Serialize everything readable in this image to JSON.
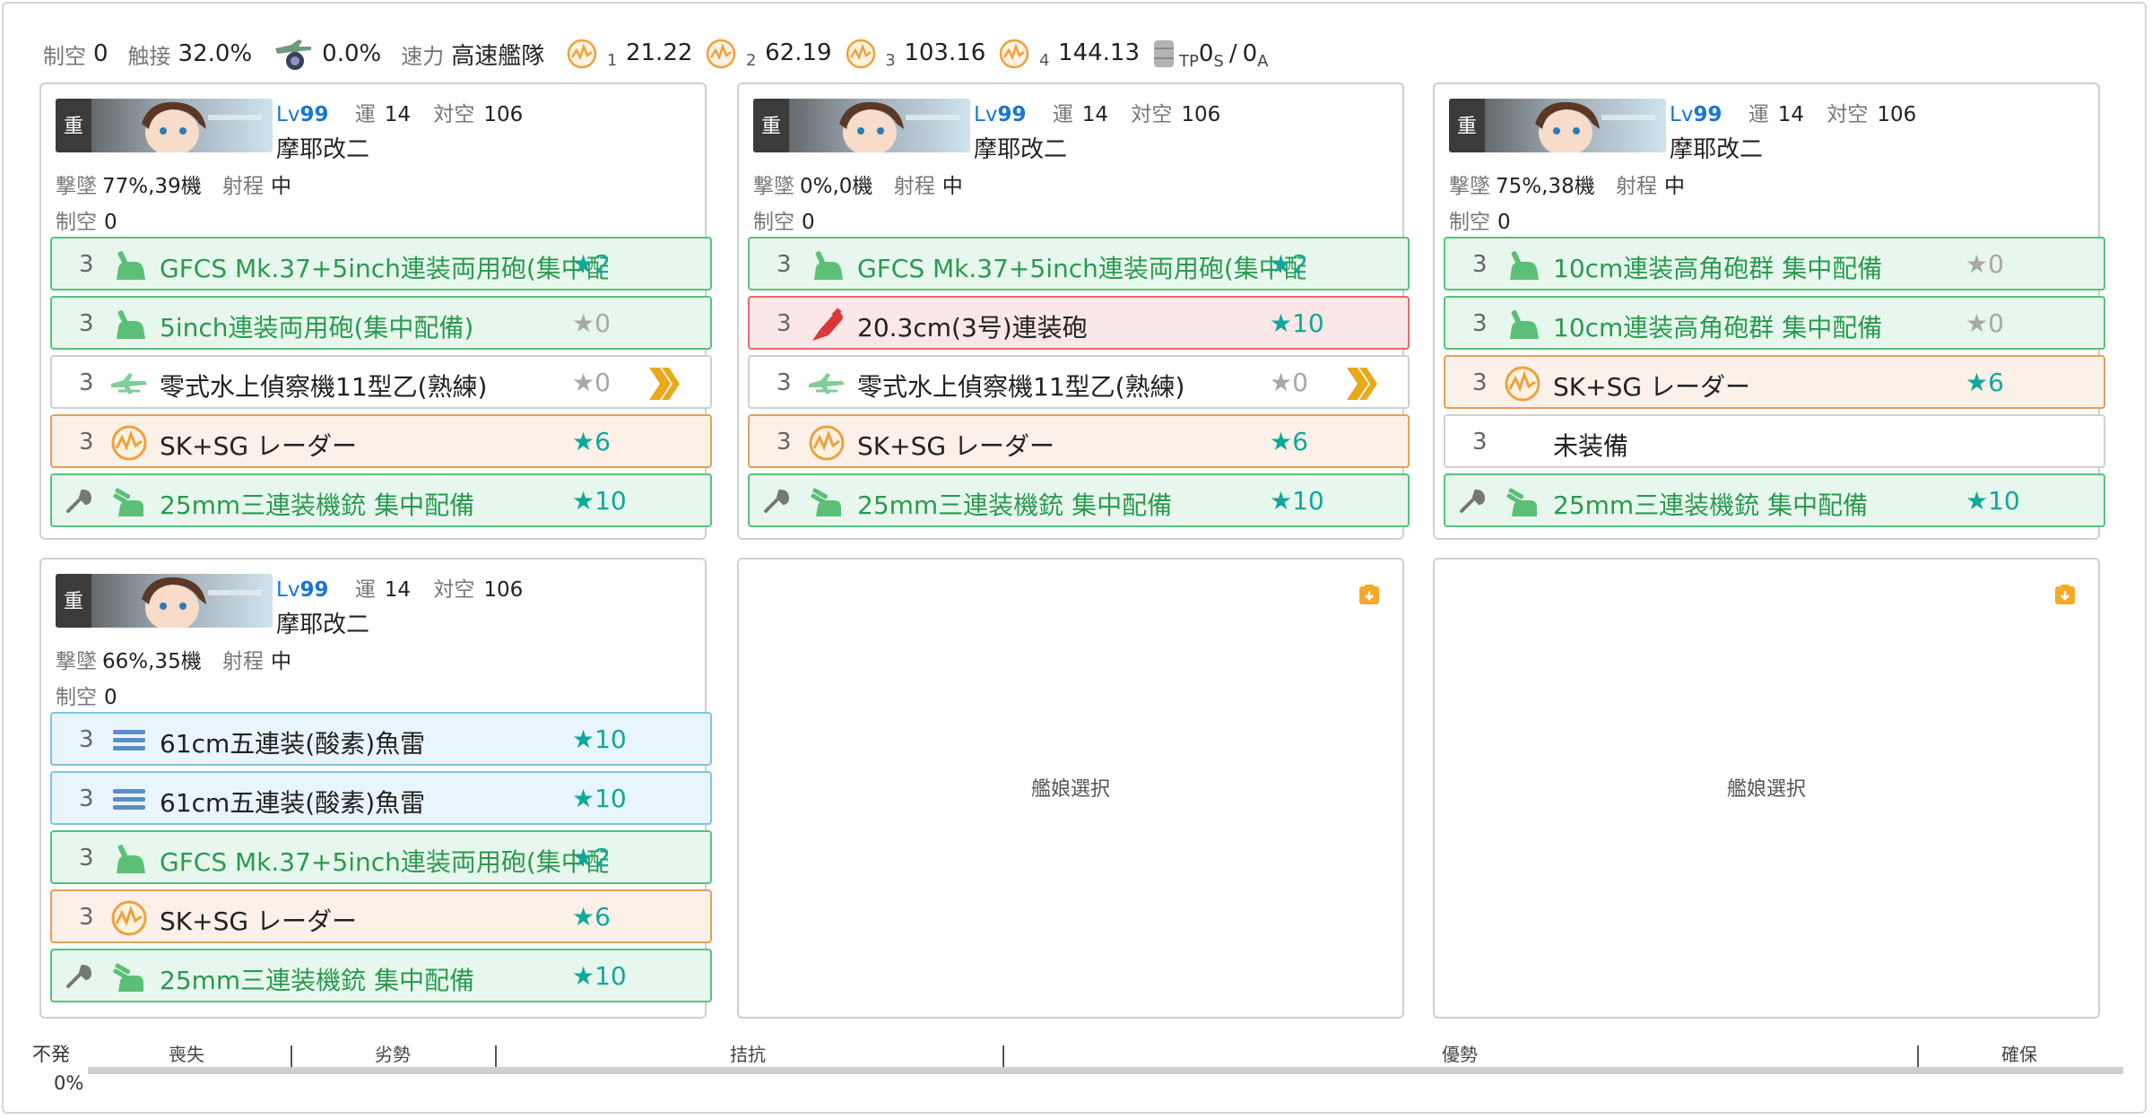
{
  "summary": {
    "seiku_label": "制空",
    "seiku_value": "0",
    "shokusetsu_label": "触接",
    "shokusetsu_value": "32.0%",
    "plane_rate": "0.0%",
    "speed_label": "速力",
    "speed_value": "高速艦隊",
    "los": [
      {
        "sub": "1",
        "value": "21.22"
      },
      {
        "sub": "2",
        "value": "62.19"
      },
      {
        "sub": "3",
        "value": "103.16"
      },
      {
        "sub": "4",
        "value": "144.13"
      }
    ],
    "tp_sub": "TP",
    "tp_s_value": "0",
    "tp_s_sub": "S",
    "tp_sep": "/",
    "tp_a_value": "0",
    "tp_a_sub": "A"
  },
  "ships": [
    {
      "lv_label": "Lv",
      "lv": "99",
      "luck_label": "運",
      "luck": "14",
      "aa_label": "対空",
      "aa": "106",
      "name": "摩耶改二",
      "shootdown_label": "撃墜",
      "shootdown": "77%,39機",
      "range_label": "射程",
      "range": "中",
      "seiku_label": "制空",
      "seiku": "0",
      "slots": [
        {
          "count": "3",
          "name": "GFCS Mk.37+5inch連装両用砲(集中配備)",
          "star": "★2",
          "color": "green",
          "icon": "hagun-icon",
          "star_style": "teal"
        },
        {
          "count": "3",
          "name": "5inch連装両用砲(集中配備)",
          "star": "★0",
          "color": "green",
          "icon": "hagun-icon",
          "star_style": "gray"
        },
        {
          "count": "3",
          "name": "零式水上偵察機11型乙(熟練)",
          "star": "★0",
          "color": "white",
          "icon": "seaplane-icon",
          "star_style": "gray",
          "prof": true
        },
        {
          "count": "3",
          "name": "SK+SG レーダー",
          "star": "★6",
          "color": "orange",
          "icon": "radar-icon",
          "star_style": "teal"
        },
        {
          "count": "",
          "name": "25mm三連装機銃 集中配備",
          "star": "★10",
          "color": "green",
          "icon": "aa-gun-icon",
          "star_style": "teal",
          "ex": true
        }
      ]
    },
    {
      "lv_label": "Lv",
      "lv": "99",
      "luck_label": "運",
      "luck": "14",
      "aa_label": "対空",
      "aa": "106",
      "name": "摩耶改二",
      "shootdown_label": "撃墜",
      "shootdown": "0%,0機",
      "range_label": "射程",
      "range": "中",
      "seiku_label": "制空",
      "seiku": "0",
      "slots": [
        {
          "count": "3",
          "name": "GFCS Mk.37+5inch連装両用砲(集中配備)",
          "star": "★2",
          "color": "green",
          "icon": "hagun-icon",
          "star_style": "teal"
        },
        {
          "count": "3",
          "name": "20.3cm(3号)連装砲",
          "star": "★10",
          "color": "red",
          "icon": "main-gun-icon",
          "star_style": "teal"
        },
        {
          "count": "3",
          "name": "零式水上偵察機11型乙(熟練)",
          "star": "★0",
          "color": "white",
          "icon": "seaplane-icon",
          "star_style": "gray",
          "prof": true
        },
        {
          "count": "3",
          "name": "SK+SG レーダー",
          "star": "★6",
          "color": "orange",
          "icon": "radar-icon",
          "star_style": "teal"
        },
        {
          "count": "",
          "name": "25mm三連装機銃 集中配備",
          "star": "★10",
          "color": "green",
          "icon": "aa-gun-icon",
          "star_style": "teal",
          "ex": true
        }
      ]
    },
    {
      "lv_label": "Lv",
      "lv": "99",
      "luck_label": "運",
      "luck": "14",
      "aa_label": "対空",
      "aa": "106",
      "name": "摩耶改二",
      "shootdown_label": "撃墜",
      "shootdown": "75%,38機",
      "range_label": "射程",
      "range": "中",
      "seiku_label": "制空",
      "seiku": "0",
      "slots": [
        {
          "count": "3",
          "name": "10cm連装高角砲群 集中配備",
          "star": "★0",
          "color": "green",
          "icon": "hagun-icon",
          "star_style": "gray"
        },
        {
          "count": "3",
          "name": "10cm連装高角砲群 集中配備",
          "star": "★0",
          "color": "green",
          "icon": "hagun-icon",
          "star_style": "gray"
        },
        {
          "count": "3",
          "name": "SK+SG レーダー",
          "star": "★6",
          "color": "orange",
          "icon": "radar-icon",
          "star_style": "teal"
        },
        {
          "count": "3",
          "name": "未装備",
          "star": "",
          "color": "white",
          "icon": "",
          "star_style": "gray"
        },
        {
          "count": "",
          "name": "25mm三連装機銃 集中配備",
          "star": "★10",
          "color": "green",
          "icon": "aa-gun-icon",
          "star_style": "teal",
          "ex": true
        }
      ]
    },
    {
      "lv_label": "Lv",
      "lv": "99",
      "luck_label": "運",
      "luck": "14",
      "aa_label": "対空",
      "aa": "106",
      "name": "摩耶改二",
      "shootdown_label": "撃墜",
      "shootdown": "66%,35機",
      "range_label": "射程",
      "range": "中",
      "seiku_label": "制空",
      "seiku": "0",
      "slots": [
        {
          "count": "3",
          "name": "61cm五連装(酸素)魚雷",
          "star": "★10",
          "color": "blue",
          "icon": "torpedo-icon",
          "star_style": "teal"
        },
        {
          "count": "3",
          "name": "61cm五連装(酸素)魚雷",
          "star": "★10",
          "color": "blue",
          "icon": "torpedo-icon",
          "star_style": "teal"
        },
        {
          "count": "3",
          "name": "GFCS Mk.37+5inch連装両用砲(集中配備)",
          "star": "★2",
          "color": "green",
          "icon": "hagun-icon",
          "star_style": "teal"
        },
        {
          "count": "3",
          "name": "SK+SG レーダー",
          "star": "★6",
          "color": "orange",
          "icon": "radar-icon",
          "star_style": "teal"
        },
        {
          "count": "",
          "name": "25mm三連装機銃 集中配備",
          "star": "★10",
          "color": "green",
          "icon": "aa-gun-icon",
          "star_style": "teal",
          "ex": true
        }
      ]
    }
  ],
  "empty_slots": [
    {
      "label": "艦娘選択"
    },
    {
      "label": "艦娘選択"
    }
  ],
  "gauge": {
    "left_top": "不発",
    "left_bottom": "0%",
    "labels": [
      "喪失",
      "劣勢",
      "拮抗",
      "優勢",
      "確保"
    ]
  },
  "colors": {
    "green": "#54c37c",
    "red": "#e46a6a",
    "orange": "#e5a059",
    "blue": "#7fc3e8",
    "teal_star": "#12a79b",
    "lv_blue": "#1976d2"
  }
}
